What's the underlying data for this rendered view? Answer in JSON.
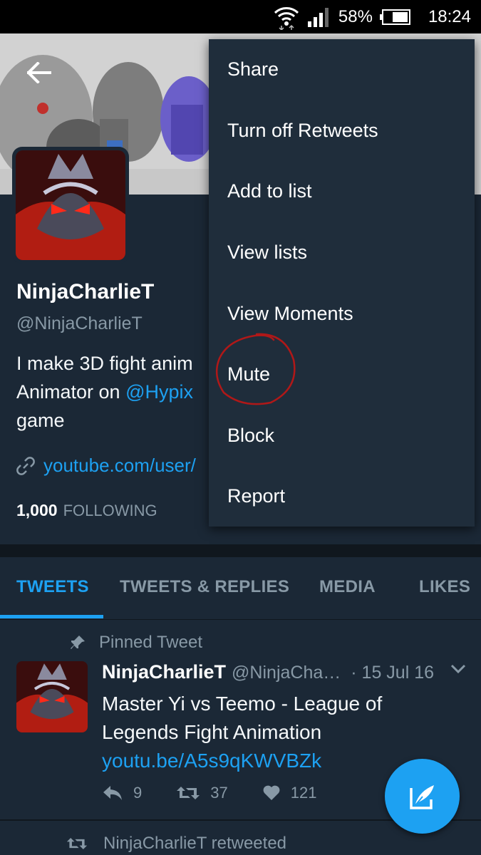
{
  "status_bar": {
    "battery": "58%",
    "time": "18:24"
  },
  "profile": {
    "name": "NinjaCharlieT",
    "handle": "@NinjaCharlieT",
    "bio_line1": "I make 3D fight anim",
    "bio_line2_prefix": "Animator on ",
    "bio_mention": "@Hypix",
    "bio_line3": "game",
    "link": "youtube.com/user/",
    "following_count": "1,000",
    "following_label": "FOLLOWING"
  },
  "tabs": [
    {
      "label": "TWEETS"
    },
    {
      "label": "TWEETS & REPLIES"
    },
    {
      "label": "MEDIA"
    },
    {
      "label": "LIKES"
    }
  ],
  "menu": {
    "items": [
      {
        "label": "Share"
      },
      {
        "label": "Turn off Retweets"
      },
      {
        "label": "Add to list"
      },
      {
        "label": "View lists"
      },
      {
        "label": "View Moments"
      },
      {
        "label": "Mute"
      },
      {
        "label": "Block"
      },
      {
        "label": "Report"
      }
    ]
  },
  "tweet": {
    "pinned_label": "Pinned Tweet",
    "name": "NinjaCharlieT",
    "handle": "@NinjaCha…",
    "date": "· 15 Jul 16",
    "text_line1": "Master Yi vs Teemo - League of",
    "text_line2": "Legends Fight Animation",
    "link": "youtu.be/A5s9qKWVBZk",
    "replies": "9",
    "retweets": "37",
    "likes": "121"
  },
  "next_item": {
    "retweeted_label": "NinjaCharlieT retweeted"
  },
  "colors": {
    "background": "#1b2836",
    "accent": "#1da1f2",
    "menu_bg": "#1f2d3b",
    "annotation_circle": "#b01818"
  }
}
